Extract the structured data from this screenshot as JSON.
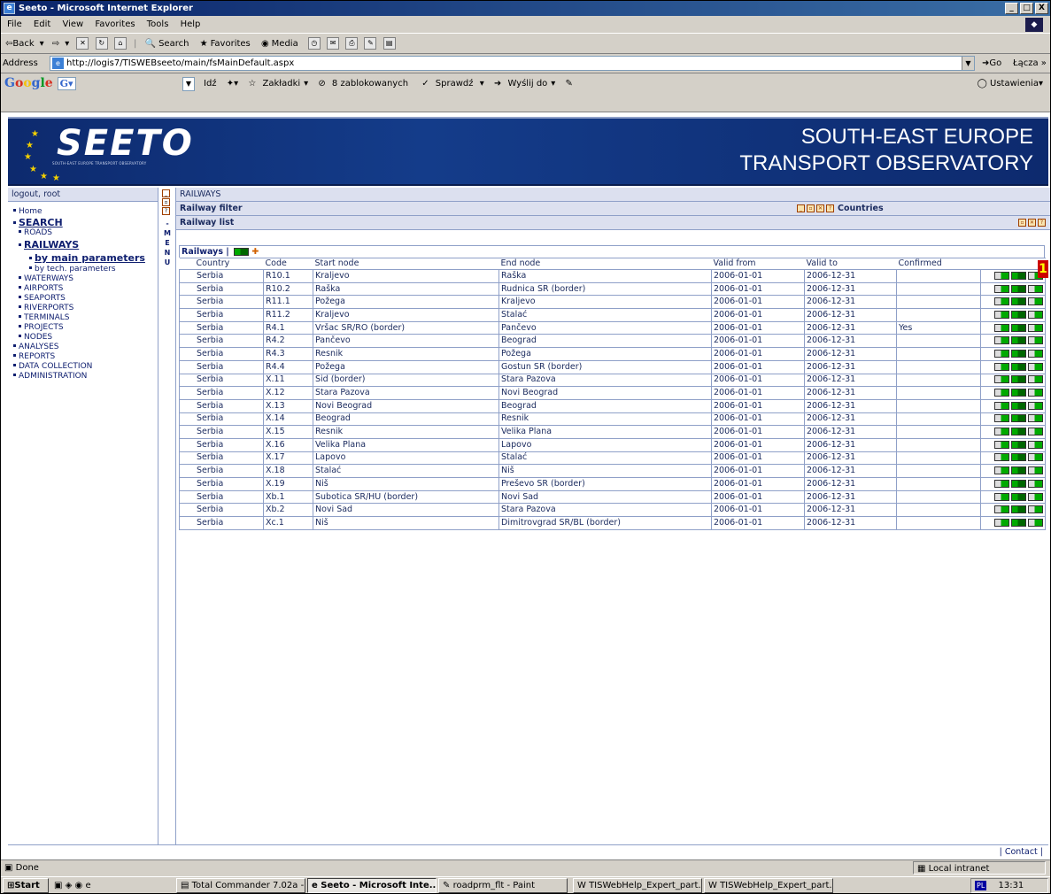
{
  "window": {
    "title": "Seeto - Microsoft Internet Explorer",
    "controls": [
      "_",
      "□",
      "X"
    ]
  },
  "menubar": [
    "File",
    "Edit",
    "View",
    "Favorites",
    "Tools",
    "Help"
  ],
  "toolbar": {
    "back": "⇦Back",
    "forward": "⇨",
    "search": "Search",
    "favorites": "Favorites",
    "media": "Media"
  },
  "address": {
    "label": "Address",
    "url": "http://logis7/TISWEBseeto/main/fsMainDefault.aspx",
    "go": "Go",
    "links": "Łącza »"
  },
  "google": {
    "idz": "Idź",
    "zakladki": "Zakładki",
    "blocked": "8 zablokowanych",
    "sprawdz": "Sprawdź",
    "wyslij": "Wyślij do",
    "ustawienia": "Ustawienia"
  },
  "header": {
    "logo": "SEETO",
    "logo_sub": "SOUTH-EAST EUROPE TRANSPORT OBSERVATORY",
    "title_line1": "SOUTH-EAST EUROPE",
    "title_line2": "TRANSPORT OBSERVATORY"
  },
  "user": "logout, root",
  "breadcrumb": "RAILWAYS",
  "nav": {
    "home": "Home",
    "search": "SEARCH",
    "roads": "ROADS",
    "railways": "RAILWAYS",
    "by_main": "by main parameters",
    "by_tech": "by tech. parameters",
    "waterways": "WATERWAYS",
    "airports": "AIRPORTS",
    "seaports": "SEAPORTS",
    "riverports": "RIVERPORTS",
    "terminals": "TERMINALS",
    "projects": "PROJECTS",
    "nodes": "NODES",
    "analyses": "ANALYSES",
    "reports": "REPORTS",
    "data_collection": "DATA COLLECTION",
    "administration": "ADMINISTRATION"
  },
  "menu_strip_letters": "- M E N U",
  "filter_bar": {
    "title": "Railway filter",
    "countries": "Countries"
  },
  "list_bar": {
    "title": "Railway list"
  },
  "table": {
    "caption": "Railways |",
    "columns": [
      "Country",
      "Code",
      "Start node",
      "End node",
      "Valid from",
      "Valid to",
      "Confirmed"
    ],
    "rows": [
      [
        "Serbia",
        "R10.1",
        "Kraljevo",
        "Raška",
        "2006-01-01",
        "2006-12-31",
        ""
      ],
      [
        "Serbia",
        "R10.2",
        "Raška",
        "Rudnica SR (border)",
        "2006-01-01",
        "2006-12-31",
        ""
      ],
      [
        "Serbia",
        "R11.1",
        "Požega",
        "Kraljevo",
        "2006-01-01",
        "2006-12-31",
        ""
      ],
      [
        "Serbia",
        "R11.2",
        "Kraljevo",
        "Stalać",
        "2006-01-01",
        "2006-12-31",
        ""
      ],
      [
        "Serbia",
        "R4.1",
        "Vršac SR/RO (border)",
        "Pančevo",
        "2006-01-01",
        "2006-12-31",
        "Yes"
      ],
      [
        "Serbia",
        "R4.2",
        "Pančevo",
        "Beograd",
        "2006-01-01",
        "2006-12-31",
        ""
      ],
      [
        "Serbia",
        "R4.3",
        "Resnik",
        "Požega",
        "2006-01-01",
        "2006-12-31",
        ""
      ],
      [
        "Serbia",
        "R4.4",
        "Požega",
        "Gostun SR (border)",
        "2006-01-01",
        "2006-12-31",
        ""
      ],
      [
        "Serbia",
        "X.11",
        "Šid (border)",
        "Stara Pazova",
        "2006-01-01",
        "2006-12-31",
        ""
      ],
      [
        "Serbia",
        "X.12",
        "Stara Pazova",
        "Novi Beograd",
        "2006-01-01",
        "2006-12-31",
        ""
      ],
      [
        "Serbia",
        "X.13",
        "Novi Beograd",
        "Beograd",
        "2006-01-01",
        "2006-12-31",
        ""
      ],
      [
        "Serbia",
        "X.14",
        "Beograd",
        "Resnik",
        "2006-01-01",
        "2006-12-31",
        ""
      ],
      [
        "Serbia",
        "X.15",
        "Resnik",
        "Velika Plana",
        "2006-01-01",
        "2006-12-31",
        ""
      ],
      [
        "Serbia",
        "X.16",
        "Velika Plana",
        "Lapovo",
        "2006-01-01",
        "2006-12-31",
        ""
      ],
      [
        "Serbia",
        "X.17",
        "Lapovo",
        "Stalać",
        "2006-01-01",
        "2006-12-31",
        ""
      ],
      [
        "Serbia",
        "X.18",
        "Stalać",
        "Niš",
        "2006-01-01",
        "2006-12-31",
        ""
      ],
      [
        "Serbia",
        "X.19",
        "Niš",
        "Preševo SR (border)",
        "2006-01-01",
        "2006-12-31",
        ""
      ],
      [
        "Serbia",
        "Xb.1",
        "Subotica SR/HU (border)",
        "Novi Sad",
        "2006-01-01",
        "2006-12-31",
        ""
      ],
      [
        "Serbia",
        "Xb.2",
        "Novi Sad",
        "Stara Pazova",
        "2006-01-01",
        "2006-12-31",
        ""
      ],
      [
        "Serbia",
        "Xc.1",
        "Niš",
        "Dimitrovgrad SR/BL (border)",
        "2006-01-01",
        "2006-12-31",
        ""
      ]
    ]
  },
  "badge": "1",
  "footer": "| Contact |",
  "status": {
    "left": "Done",
    "zone": "Local intranet"
  },
  "taskbar": {
    "start": "Start",
    "tasks": [
      "Total Commander 7.02a -...",
      "Seeto - Microsoft Inte...",
      "roadprm_flt - Paint",
      "TISWebHelp_Expert_part...",
      "TISWebHelp_Expert_part..."
    ],
    "lang": "PL",
    "time": "13:31"
  }
}
